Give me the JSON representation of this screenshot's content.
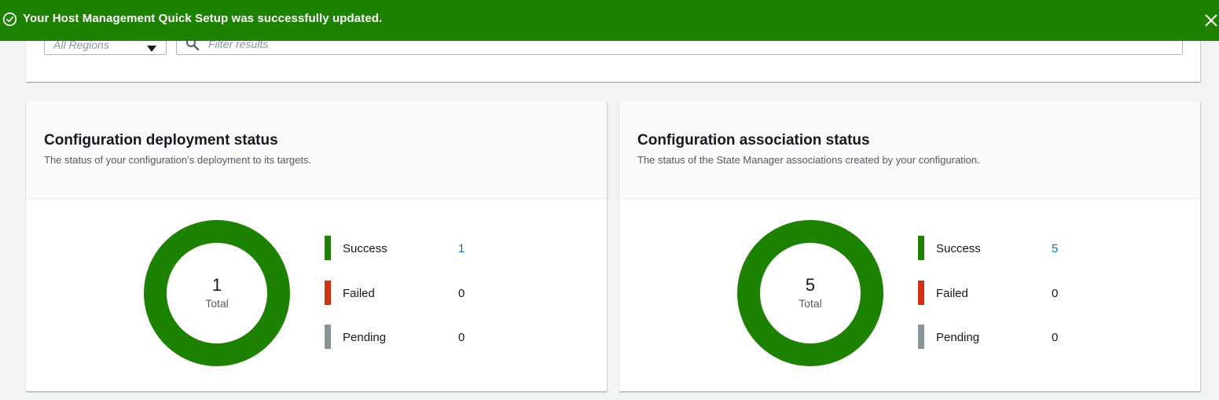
{
  "flash": {
    "message": "Your Host Management Quick Setup was successfully updated.",
    "color": "#1d8102",
    "icon": "check-circle-icon",
    "close_icon": "close-icon"
  },
  "filters": {
    "region_placeholder": "All Regions",
    "search_placeholder": "Filter results",
    "search_value": ""
  },
  "cards": [
    {
      "title": "Configuration deployment status",
      "description": "The status of your configuration’s deployment to its targets.",
      "total": "1",
      "total_label": "Total",
      "legend": [
        {
          "label": "Success",
          "value": "1",
          "color": "#1d8102"
        },
        {
          "label": "Failed",
          "value": "0",
          "color": "#d13212"
        },
        {
          "label": "Pending",
          "value": "0",
          "color": "#879596"
        }
      ]
    },
    {
      "title": "Configuration association status",
      "description": "The status of the State Manager associations created by your configuration.",
      "total": "5",
      "total_label": "Total",
      "legend": [
        {
          "label": "Success",
          "value": "5",
          "color": "#1d8102"
        },
        {
          "label": "Failed",
          "value": "0",
          "color": "#d13212"
        },
        {
          "label": "Pending",
          "value": "0",
          "color": "#879596"
        }
      ]
    }
  ]
}
